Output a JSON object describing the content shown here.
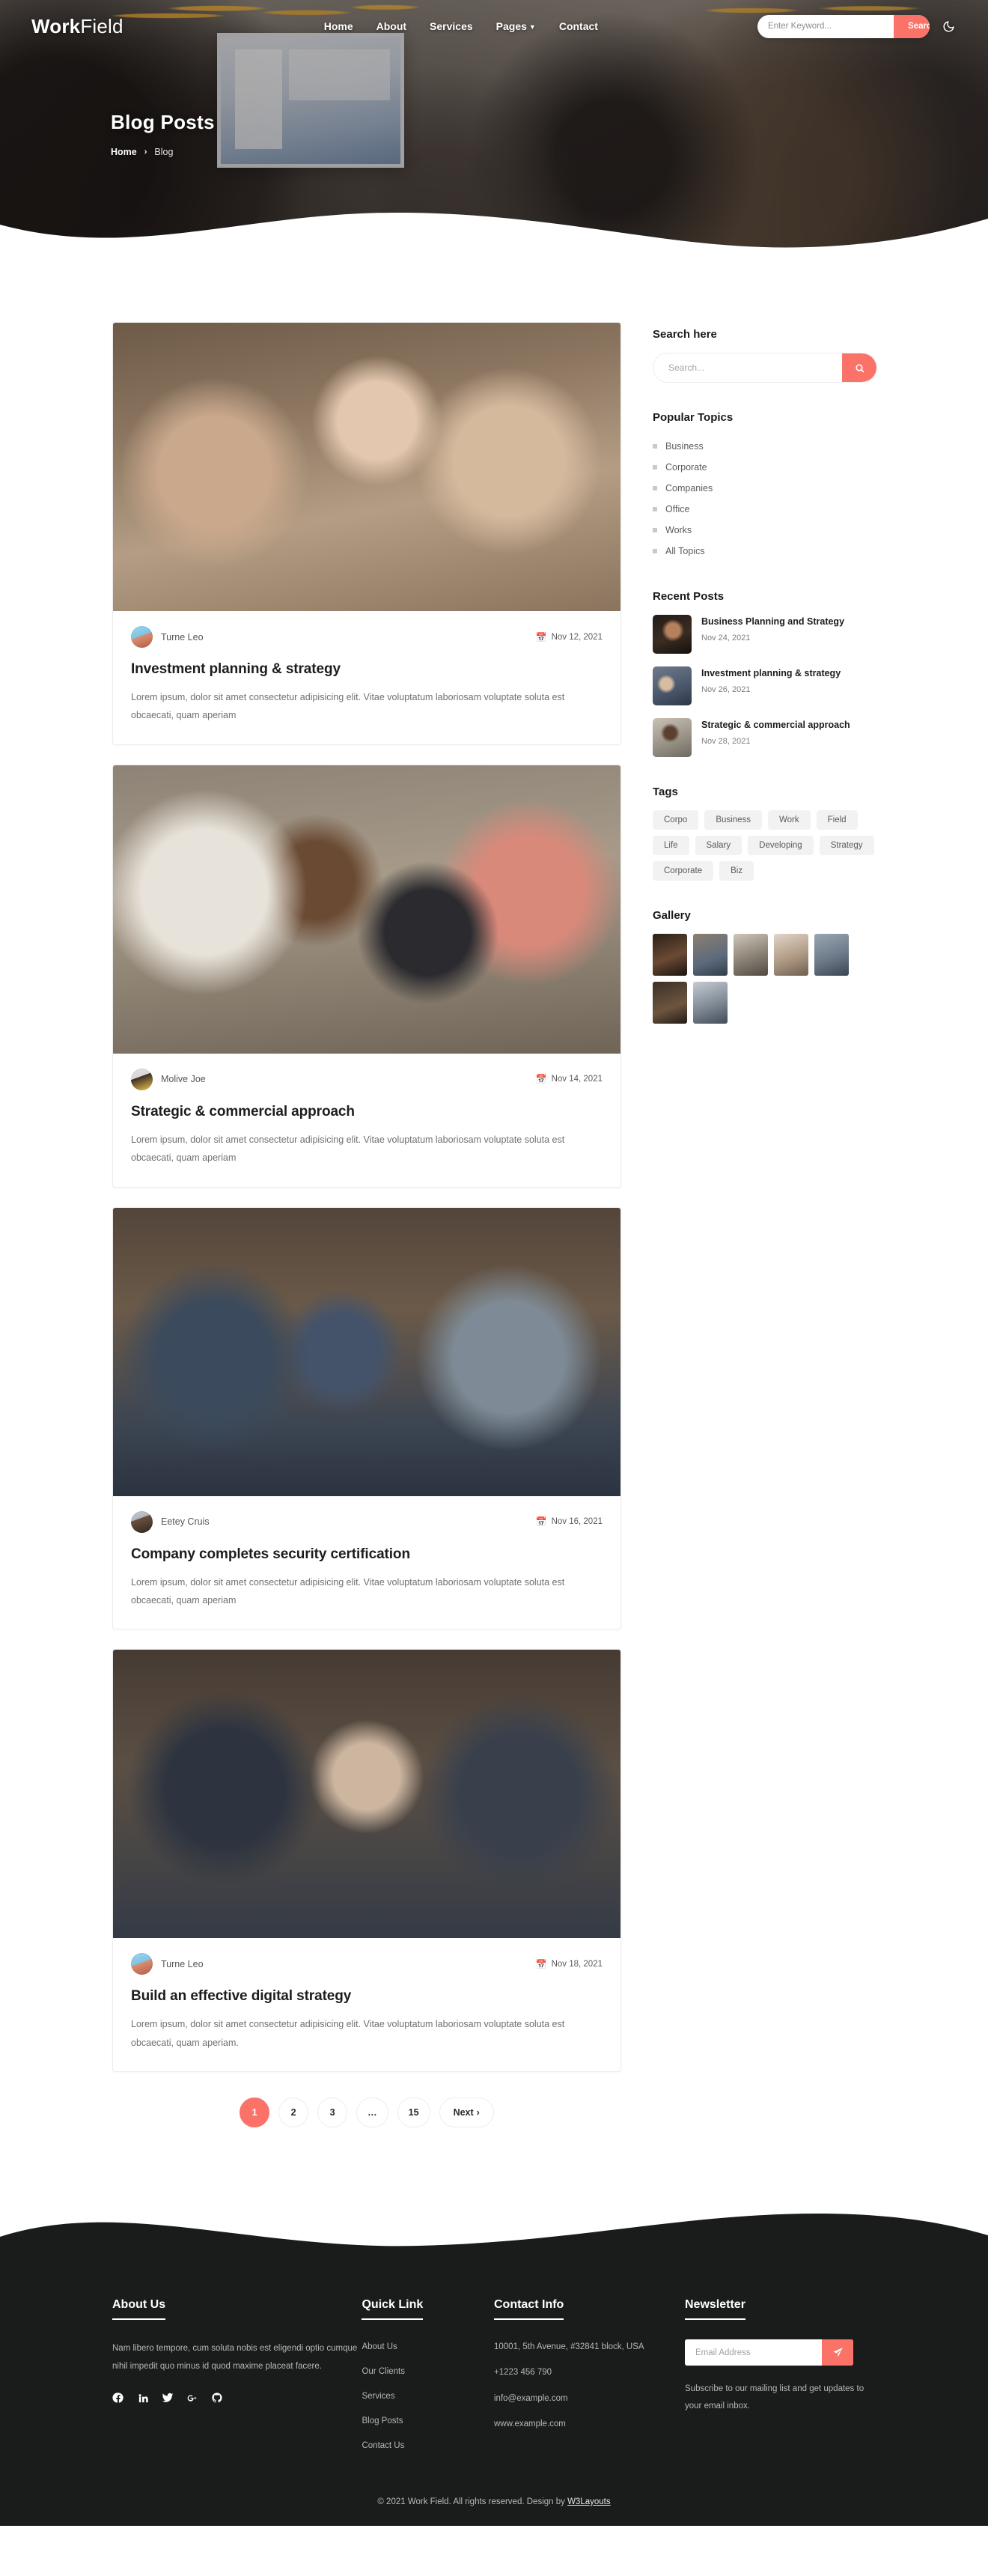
{
  "brand": {
    "bold": "Work",
    "light": "Field"
  },
  "nav": [
    {
      "label": "Home",
      "has_caret": false
    },
    {
      "label": "About",
      "has_caret": false
    },
    {
      "label": "Services",
      "has_caret": false
    },
    {
      "label": "Pages",
      "has_caret": true
    },
    {
      "label": "Contact",
      "has_caret": false
    }
  ],
  "header_search": {
    "placeholder": "Enter Keyword...",
    "button_label": "Search",
    "theme_toggle_icon": "moon-icon"
  },
  "hero": {
    "title": "Blog Posts",
    "breadcrumb_home": "Home",
    "breadcrumb_sep": "›",
    "breadcrumb_current": "Blog"
  },
  "posts": [
    {
      "author": "Turne Leo",
      "date": "Nov 12, 2021",
      "title": "Investment planning & strategy",
      "text": "Lorem ipsum, dolor sit amet consectetur adipisicing elit. Vitae voluptatum laboriosam voluptate soluta est obcaecati, quam aperiam"
    },
    {
      "author": "Molive Joe",
      "date": "Nov 14, 2021",
      "title": "Strategic & commercial approach",
      "text": "Lorem ipsum, dolor sit amet consectetur adipisicing elit. Vitae voluptatum laboriosam voluptate soluta est obcaecati, quam aperiam"
    },
    {
      "author": "Eetey Cruis",
      "date": "Nov 16, 2021",
      "title": "Company completes security certification",
      "text": "Lorem ipsum, dolor sit amet consectetur adipisicing elit. Vitae voluptatum laboriosam voluptate soluta est obcaecati, quam aperiam"
    },
    {
      "author": "Turne Leo",
      "date": "Nov 18, 2021",
      "title": "Build an effective digital strategy",
      "text": "Lorem ipsum, dolor sit amet consectetur adipisicing elit. Vitae voluptatum laboriosam voluptate soluta est obcaecati, quam aperiam."
    }
  ],
  "pagination": {
    "pages": [
      "1",
      "2",
      "3",
      "…",
      "15"
    ],
    "active": "1",
    "next_label": "Next"
  },
  "sidebar": {
    "search_heading": "Search here",
    "search_placeholder": "Search...",
    "search_icon": "magnifier-icon",
    "topics_heading": "Popular Topics",
    "topics": [
      "Business",
      "Corporate",
      "Companies",
      "Office",
      "Works",
      "All Topics"
    ],
    "recent_heading": "Recent Posts",
    "recent": [
      {
        "title": "Business Planning and Strategy",
        "date": "Nov 24, 2021"
      },
      {
        "title": "Investment planning & strategy",
        "date": "Nov 26, 2021"
      },
      {
        "title": "Strategic & commercial approach",
        "date": "Nov 28, 2021"
      }
    ],
    "tags_heading": "Tags",
    "tags": [
      "Corpo",
      "Business",
      "Work",
      "Field",
      "Life",
      "Salary",
      "Developing",
      "Strategy",
      "Corporate",
      "Biz"
    ],
    "gallery_heading": "Gallery",
    "gallery_count": 7
  },
  "footer": {
    "about_heading": "About Us",
    "about_text": "Nam libero tempore, cum soluta nobis est eligendi optio cumque nihil impedit quo minus id quod maxime placeat facere.",
    "socials": [
      "facebook-icon",
      "linkedin-icon",
      "twitter-icon",
      "google-plus-icon",
      "github-icon"
    ],
    "quicklink_heading": "Quick Link",
    "quicklinks": [
      "About Us",
      "Our Clients",
      "Services",
      "Blog Posts",
      "Contact Us"
    ],
    "contact_heading": "Contact Info",
    "contact_address": "10001, 5th Avenue, #32841 block, USA",
    "contact_phone": "+1223 456 790",
    "contact_email": "info@example.com",
    "contact_site": "www.example.com",
    "newsletter_heading": "Newsletter",
    "newsletter_placeholder": "Email Address",
    "newsletter_button_icon": "paper-plane-icon",
    "newsletter_text": "Subscribe to our mailing list and get updates to your email inbox.",
    "copyright_prefix": "© 2021 Work Field. All rights reserved. Design by ",
    "copyright_link": "W3Layouts"
  },
  "colors": {
    "accent": "#fa7268",
    "footer_bg": "#191c1b",
    "text_dark": "#1d1d1d"
  }
}
